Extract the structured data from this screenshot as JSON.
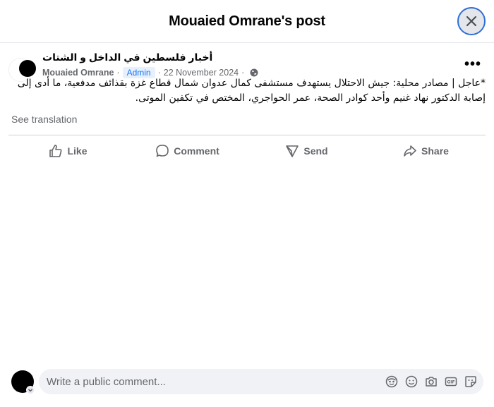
{
  "dialog": {
    "title": "Mouaied Omrane's post"
  },
  "post": {
    "group_name": "أخبار فلسطين في الداخل و الشتات",
    "author": "Mouaied Omrane",
    "role_badge": "Admin",
    "date": "22 November 2024",
    "separator": "·",
    "text": "*عاجل | مصادر محلية: جيش الاحتلال يستهدف مستشفى كمال عدوان شمال قطاع غزة بقذائف مدفعية، ما أدى إلى إصابة الدكتور نهاد غنيم وأحد كوادر الصحة، عمر الحواجري، المختص في تكفين الموتى.",
    "see_translation": "See translation",
    "audience_icon": "globe-icon"
  },
  "actions": {
    "like": "Like",
    "comment": "Comment",
    "send": "Send",
    "share": "Share"
  },
  "comment": {
    "placeholder": "Write a public comment...",
    "icons": [
      "avatar-sticker-icon",
      "emoji-icon",
      "camera-icon",
      "gif-icon",
      "sticker-icon"
    ]
  },
  "colors": {
    "accent": "#1877f2",
    "muted_text": "#65676b",
    "divider": "#ced0d4",
    "focus_ring": "#2d6fd6"
  }
}
